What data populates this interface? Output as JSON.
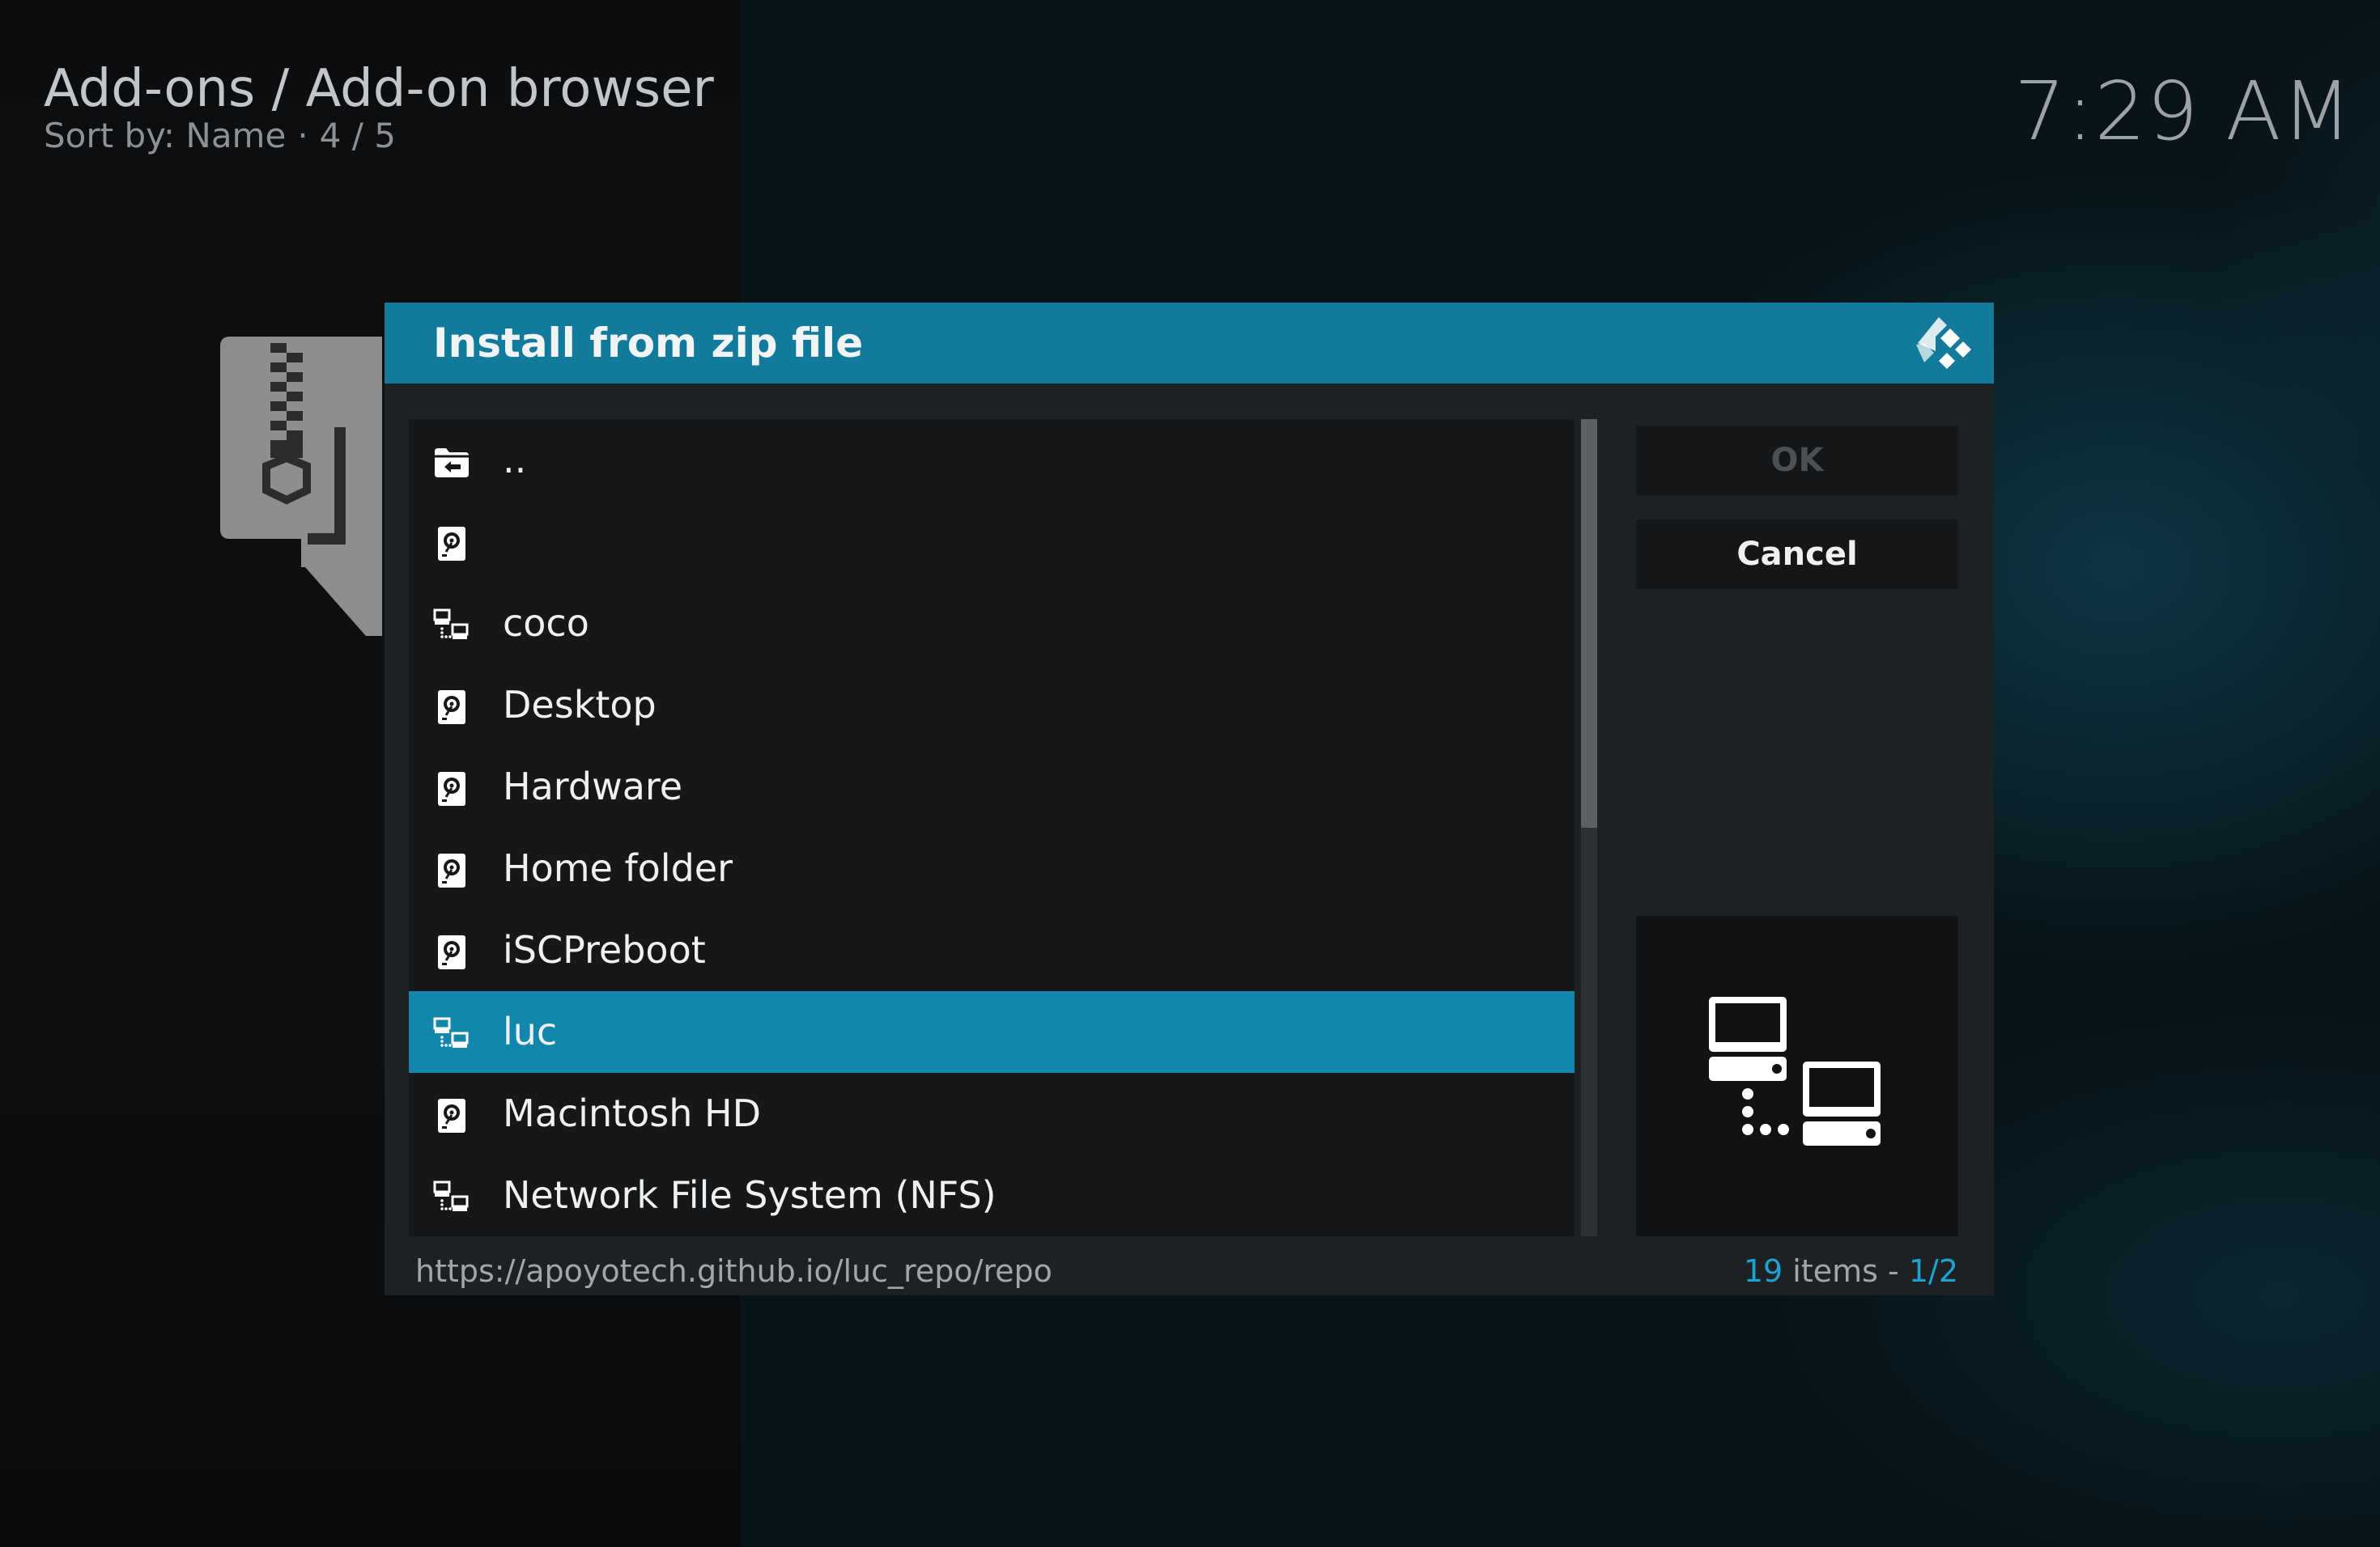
{
  "header": {
    "title": "Add-ons / Add-on browser",
    "sort_label": "Sort by: Name",
    "separator": "·",
    "position": "4 / 5",
    "clock": "7:29 AM"
  },
  "dialog": {
    "title": "Install from zip file",
    "ok_label": "OK",
    "cancel_label": "Cancel",
    "items": [
      {
        "label": "..",
        "icon": "folder-back-icon"
      },
      {
        "label": "",
        "icon": "hard-drive-icon"
      },
      {
        "label": "coco",
        "icon": "network-icon"
      },
      {
        "label": "Desktop",
        "icon": "hard-drive-icon"
      },
      {
        "label": "Hardware",
        "icon": "hard-drive-icon"
      },
      {
        "label": "Home folder",
        "icon": "hard-drive-icon"
      },
      {
        "label": "iSCPreboot",
        "icon": "hard-drive-icon"
      },
      {
        "label": "luc",
        "icon": "network-icon",
        "selected": true
      },
      {
        "label": "Macintosh HD",
        "icon": "hard-drive-icon"
      },
      {
        "label": "Network File System (NFS)",
        "icon": "network-icon"
      }
    ],
    "footer": {
      "path": "https://apoyotech.github.io/luc_repo/repo",
      "item_count": "19",
      "items_word": "items -",
      "page": "1/2"
    },
    "scroll_fraction": 0.5
  },
  "colors": {
    "accent": "#127b9c",
    "selected": "#1287ab",
    "highlight_text": "#1ea3d0"
  }
}
